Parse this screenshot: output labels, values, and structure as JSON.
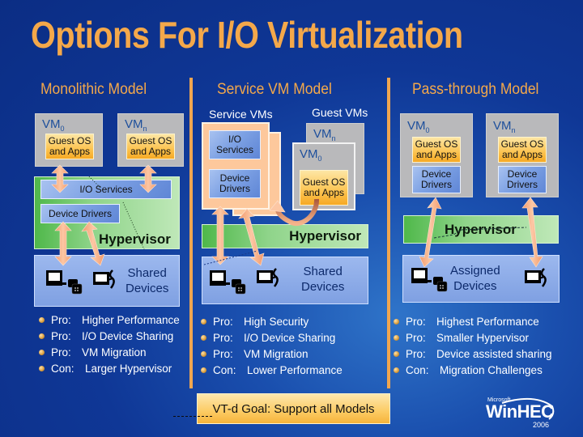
{
  "title": "Options For I/O Virtualization",
  "colors": {
    "title": "#f4a84a",
    "divider": "#f0a650",
    "guest_os": "#fcc452",
    "drivers": "#7ea2e4",
    "hypervisor": "#8fd48a",
    "devices": "#8fabe8",
    "service_vm": "#fdc89c",
    "arrow": "#f5a27a"
  },
  "models": [
    {
      "heading": "Monolithic Model",
      "vms": [
        {
          "name": "VM",
          "sub": "0",
          "guest": [
            "Guest OS",
            "and Apps"
          ]
        },
        {
          "name": "VM",
          "sub": "n",
          "guest": [
            "Guest OS",
            "and Apps"
          ]
        }
      ],
      "io_services": "I/O Services",
      "device_drivers": "Device Drivers",
      "hypervisor": "Hypervisor",
      "devices": [
        "Shared",
        "Devices"
      ],
      "pros_cons": [
        {
          "kind": "Pro:",
          "text": "Higher Performance"
        },
        {
          "kind": "Pro:",
          "text": "I/O Device Sharing"
        },
        {
          "kind": "Pro:",
          "text": "VM Migration"
        },
        {
          "kind": "Con:",
          "text": "Larger Hypervisor"
        }
      ]
    },
    {
      "heading": "Service VM Model",
      "service_vms_label": "Service VMs",
      "guest_vms_label": "Guest VMs",
      "io_services": [
        "I/O",
        "Services"
      ],
      "device_drivers": [
        "Device",
        "Drivers"
      ],
      "vms": [
        {
          "name": "VM",
          "sub": "n"
        },
        {
          "name": "VM",
          "sub": "0",
          "guest": [
            "Guest OS",
            "and Apps"
          ]
        }
      ],
      "hypervisor": "Hypervisor",
      "devices": [
        "Shared",
        "Devices"
      ],
      "pros_cons": [
        {
          "kind": "Pro:",
          "text": "High Security"
        },
        {
          "kind": "Pro:",
          "text": "I/O Device Sharing"
        },
        {
          "kind": "Pro:",
          "text": "VM Migration"
        },
        {
          "kind": "Con:",
          "text": "Lower Performance"
        }
      ]
    },
    {
      "heading": "Pass-through Model",
      "vms": [
        {
          "name": "VM",
          "sub": "0",
          "guest": [
            "Guest OS",
            "and Apps"
          ],
          "drivers": [
            "Device",
            "Drivers"
          ]
        },
        {
          "name": "VM",
          "sub": "n",
          "guest": [
            "Guest OS",
            "and Apps"
          ],
          "drivers": [
            "Device",
            "Drivers"
          ]
        }
      ],
      "hypervisor": "Hypervisor",
      "devices": [
        "Assigned",
        "Devices"
      ],
      "pros_cons": [
        {
          "kind": "Pro:",
          "text": "Highest Performance"
        },
        {
          "kind": "Pro:",
          "text": "Smaller Hypervisor"
        },
        {
          "kind": "Pro:",
          "text": "Device assisted sharing"
        },
        {
          "kind": "Con:",
          "text": "Migration Challenges"
        }
      ]
    }
  ],
  "goal": "VT-d Goal: Support all Models",
  "logo": {
    "brand": "Microsoft",
    "name": "WinHEC",
    "year": "2006"
  },
  "icons": [
    "computer-icon",
    "disk-stack-icon",
    "network-device-icon"
  ]
}
